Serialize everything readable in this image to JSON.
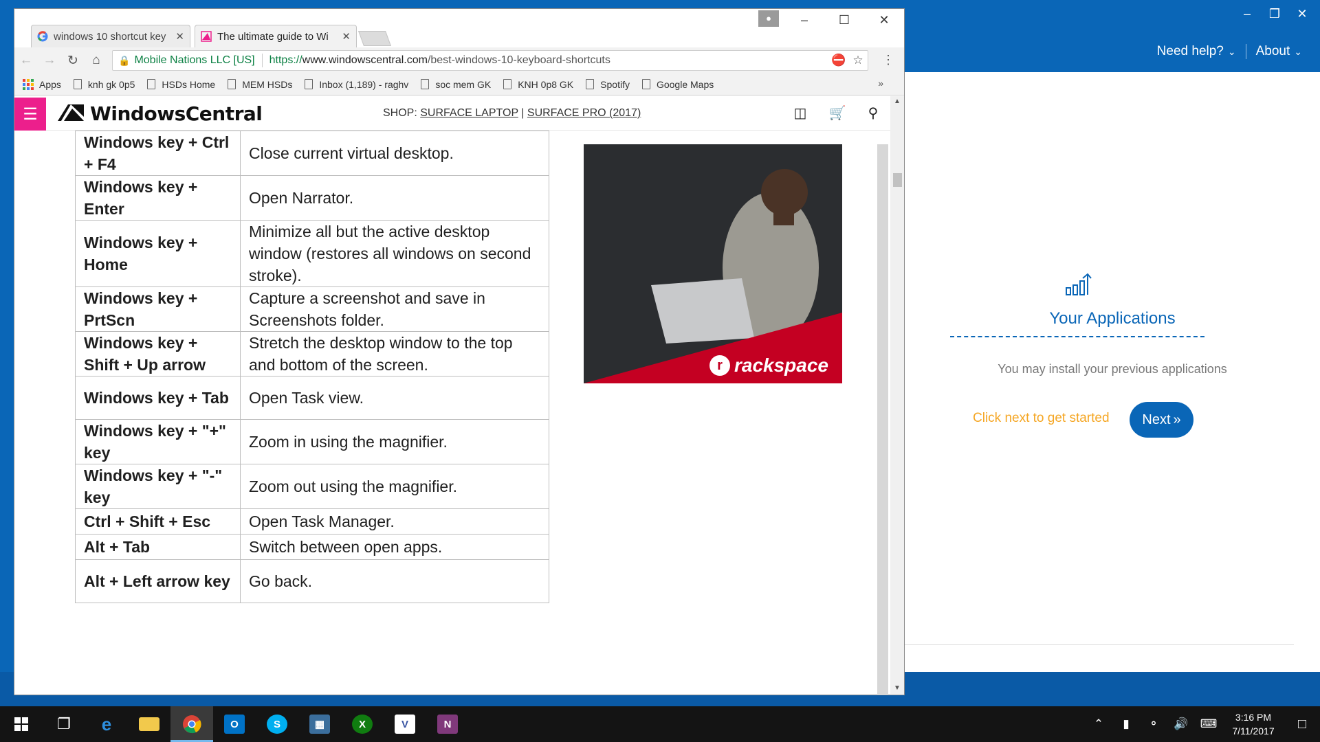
{
  "background_app": {
    "nav": {
      "help": "Need help?",
      "about": "About"
    },
    "panel": {
      "title": "Your Applications",
      "subtitle": "You may install your previous applications",
      "cta": "Click next to get started",
      "next_button": "Next"
    },
    "colors": {
      "brand": "#0a66b7",
      "cta": "#f5a623"
    }
  },
  "browser": {
    "tabs": [
      {
        "title": "windows 10 shortcut key",
        "favicon": "google-icon"
      },
      {
        "title": "The ultimate guide to Wi",
        "favicon": "windowscentral-icon"
      }
    ],
    "omnibox": {
      "ev_label": "Mobile Nations LLC [US]",
      "url_scheme": "https://",
      "url_host": "www.windowscentral.com",
      "url_path": "/best-windows-10-keyboard-shortcuts"
    },
    "bookmarks": [
      "Apps",
      "knh gk 0p5",
      "HSDs Home",
      "MEM HSDs",
      "Inbox (1,189) - raghv",
      "soc mem GK",
      "KNH 0p8 GK",
      "Spotify",
      "Google Maps"
    ],
    "bookmarks_more": "»"
  },
  "site": {
    "logo": "WindowsCentral",
    "shop_label": "SHOP:",
    "shop_links": [
      "SURFACE LAPTOP",
      "SURFACE PRO (2017)"
    ],
    "shop_separator": "|",
    "accent": "#ec1f8c"
  },
  "shortcuts": [
    {
      "key": "Windows key + Ctrl + F4",
      "desc": "Close current virtual desktop."
    },
    {
      "key": "Windows key + Enter",
      "desc": "Open Narrator."
    },
    {
      "key": "Windows key + Home",
      "desc": "Minimize all but the active desktop window (restores all windows on second stroke)."
    },
    {
      "key": "Windows key + PrtScn",
      "desc": "Capture a screenshot and save in Screenshots folder."
    },
    {
      "key": "Windows key + Shift + Up arrow",
      "desc": "Stretch the desktop window to the top and bottom of the screen."
    },
    {
      "key": "Windows key + Tab",
      "desc": "Open Task view."
    },
    {
      "key": "Windows key + \"+\" key",
      "desc": "Zoom in using the magnifier."
    },
    {
      "key": "Windows key + \"-\" key",
      "desc": "Zoom out using the magnifier."
    },
    {
      "key": "Ctrl + Shift + Esc",
      "desc": "Open Task Manager."
    },
    {
      "key": "Alt + Tab",
      "desc": "Switch between open apps."
    },
    {
      "key": "Alt + Left arrow key",
      "desc": "Go back."
    }
  ],
  "ad": {
    "brand": "rackspace"
  },
  "taskbar": {
    "apps": [
      "task-view-icon",
      "edge-icon",
      "file-explorer-icon",
      "chrome-icon",
      "outlook-icon",
      "skype-icon",
      "network-app-icon",
      "xbox-icon",
      "visio-icon",
      "onenote-icon"
    ],
    "time": "3:16 PM",
    "date": "7/11/2017"
  }
}
